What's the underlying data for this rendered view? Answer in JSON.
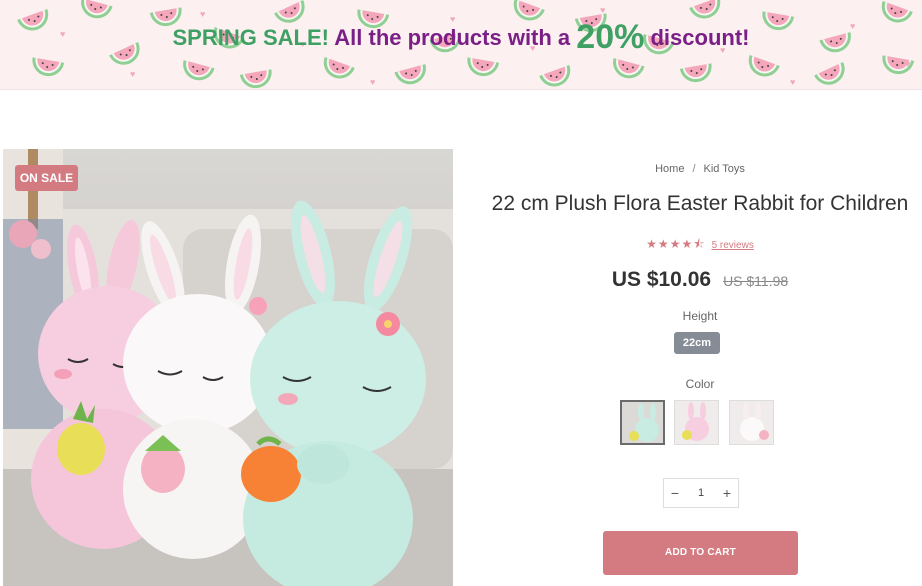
{
  "banner": {
    "part1": "SPRING SALE!",
    "part2": "All the products with a",
    "percent": "20%",
    "part3": "discount!",
    "colors": {
      "green": "#3ea063",
      "purple": "#7a1f86",
      "background": "#fdf0f1"
    }
  },
  "product": {
    "badge": "ON SALE",
    "breadcrumb": {
      "home": "Home",
      "separator": "/",
      "category": "Kid Toys"
    },
    "title": "22 cm Plush Flora Easter Rabbit for Children",
    "rating": {
      "stars": "★★★★⯪",
      "value": 4.5,
      "reviews_label": "5 reviews"
    },
    "price": "US $10.06",
    "old_price": "US $11.98",
    "height": {
      "label": "Height",
      "selected": "22cm"
    },
    "color": {
      "label": "Color",
      "swatches": [
        "mint-bunny",
        "pink-bunny",
        "white-bunny"
      ]
    },
    "quantity": {
      "minus": "−",
      "value": "1",
      "plus": "+"
    },
    "add_to_cart": "ADD TO CART",
    "accent_color": "#d47b82"
  }
}
